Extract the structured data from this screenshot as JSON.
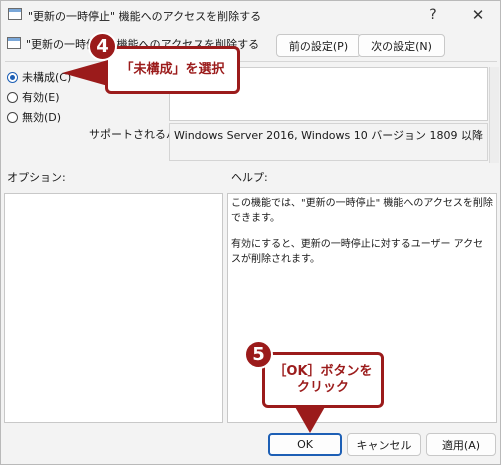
{
  "window": {
    "title": "\"更新の一時停止\" 機能へのアクセスを削除する",
    "help_glyph": "?",
    "close_glyph": "✕"
  },
  "header": {
    "title": "\"更新の一時停止\" 機能へのアクセスを削除する",
    "prev_label": "前の設定(P)",
    "next_label": "次の設定(N)"
  },
  "state": {
    "options": [
      {
        "label": "未構成(C)",
        "checked": true
      },
      {
        "label": "有効(E)",
        "checked": false
      },
      {
        "label": "無効(D)",
        "checked": false
      }
    ]
  },
  "supported": {
    "label": "サポートされるバージョン:",
    "value": "Windows Server 2016, Windows 10 バージョン 1809 以降"
  },
  "sections": {
    "options_label": "オプション:",
    "help_label": "ヘルプ:"
  },
  "help_text": {
    "p1": "この機能では、\"更新の一時停止\" 機能へのアクセスを削除できます。",
    "p2": "有効にすると、更新の一時停止に対するユーザー アクセスが削除されます。"
  },
  "footer": {
    "ok_label": "OK",
    "cancel_label": "キャンセル",
    "apply_label": "適用(A)"
  },
  "annotations": {
    "step4_number": "4",
    "step4_text": "「未構成」を選択",
    "step5_number": "5",
    "step5_line1": "［OK］ボタンを",
    "step5_line2": "クリック",
    "color": "#9b1b1b"
  }
}
